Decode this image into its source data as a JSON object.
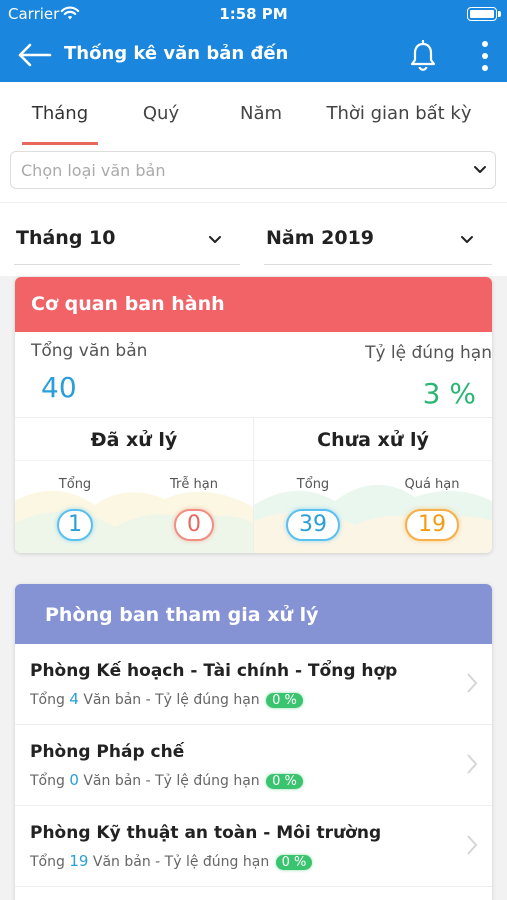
{
  "status_bar": {
    "carrier": "Carrier",
    "time": "1:58 PM"
  },
  "navbar": {
    "title": "Thống kê văn bản đến"
  },
  "tabs": [
    {
      "label": "Tháng",
      "active": true
    },
    {
      "label": "Quý",
      "active": false
    },
    {
      "label": "Năm",
      "active": false
    },
    {
      "label": "Thời gian bất kỳ",
      "active": false
    }
  ],
  "doc_type": {
    "placeholder": "Chọn loại văn bản"
  },
  "period": {
    "month": "Tháng 10",
    "year": "Năm 2019"
  },
  "issuer_card": {
    "title": "Cơ quan ban hành",
    "total_label": "Tổng văn bản",
    "total_value": "40",
    "rate_label": "Tỷ lệ đúng hạn",
    "rate_value": "3 %",
    "processed": {
      "title": "Đã xử lý",
      "total_label": "Tổng",
      "total_value": "1",
      "late_label": "Trễ hạn",
      "late_value": "0"
    },
    "unprocessed": {
      "title": "Chưa xử lý",
      "total_label": "Tổng",
      "total_value": "39",
      "overdue_label": "Quá hạn",
      "overdue_value": "19"
    }
  },
  "departments_card": {
    "title": "Phòng ban tham gia xử lý",
    "total_prefix": "Tổng",
    "docs_suffix": "Văn bản - Tỷ lệ đúng hạn",
    "items": [
      {
        "name": "Phòng Kế hoạch - Tài chính - Tổng hợp",
        "count": "4",
        "rate": "0 %"
      },
      {
        "name": "Phòng Pháp chế",
        "count": "0",
        "rate": "0 %"
      },
      {
        "name": "Phòng Kỹ thuật an toàn - Môi trường",
        "count": "19",
        "rate": "0 %"
      }
    ]
  },
  "colors": {
    "header": "#1a86dd",
    "issuer_header": "#f26368",
    "departments_header": "#8592d4",
    "accent_blue": "#2a9fd8",
    "accent_green": "#2bb673",
    "accent_red": "#e8685e",
    "accent_orange": "#f39c12"
  }
}
